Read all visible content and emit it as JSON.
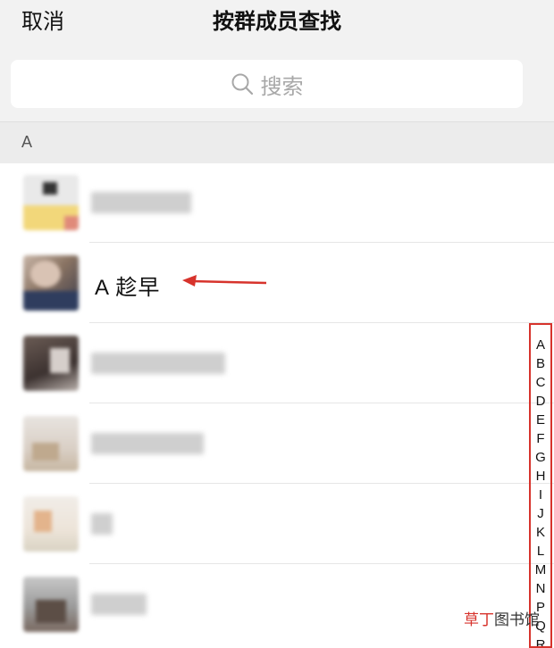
{
  "header": {
    "cancel_label": "取消",
    "title": "按群成员查找"
  },
  "search": {
    "placeholder": "搜索",
    "icon": "search-icon"
  },
  "section": {
    "letter": "A"
  },
  "members": [
    {
      "name": "",
      "blurred": true
    },
    {
      "name": "A 趁早",
      "blurred": false,
      "annotated": true
    },
    {
      "name": "",
      "blurred": true
    },
    {
      "name": "",
      "blurred": true
    },
    {
      "name": "",
      "blurred": true
    },
    {
      "name": "",
      "blurred": true
    }
  ],
  "index_bar": {
    "letters": [
      "A",
      "B",
      "C",
      "D",
      "E",
      "F",
      "G",
      "H",
      "I",
      "J",
      "K",
      "L",
      "M",
      "N",
      "P",
      "Q",
      "R"
    ],
    "highlight_color": "#d7332c"
  },
  "annotation": {
    "arrow_color": "#d7332c"
  },
  "watermark": {
    "part1": "草丁",
    "part2": "图书馆"
  }
}
